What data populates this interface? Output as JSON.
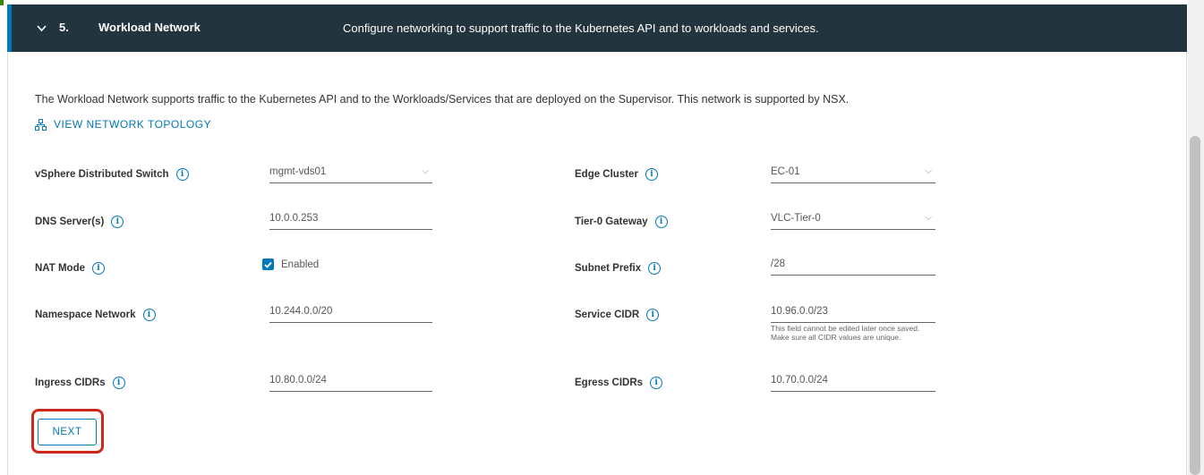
{
  "step": {
    "number": "5.",
    "title": "Workload Network",
    "description": "Configure networking to support traffic to the Kubernetes API and to workloads and services."
  },
  "intro_text": "The Workload Network supports traffic to the Kubernetes API and to the Workloads/Services that are deployed on the Supervisor. This network is supported by NSX.",
  "topology_link": "VIEW NETWORK TOPOLOGY",
  "fields": {
    "vds": {
      "label": "vSphere Distributed Switch",
      "value": "mgmt-vds01"
    },
    "edge_cluster": {
      "label": "Edge Cluster",
      "value": "EC-01"
    },
    "dns": {
      "label": "DNS Server(s)",
      "value": "10.0.0.253"
    },
    "tier0": {
      "label": "Tier-0 Gateway",
      "value": "VLC-Tier-0"
    },
    "nat": {
      "label": "NAT Mode",
      "value": "Enabled"
    },
    "subnet_prefix": {
      "label": "Subnet Prefix",
      "value": "/28"
    },
    "namespace_network": {
      "label": "Namespace Network",
      "value": "10.244.0.0/20"
    },
    "service_cidr": {
      "label": "Service CIDR",
      "value": "10.96.0.0/23",
      "hint": "This field cannot be edited later once saved. Make sure all CIDR values are unique."
    },
    "ingress": {
      "label": "Ingress CIDRs",
      "value": "10.80.0.0/24"
    },
    "egress": {
      "label": "Egress CIDRs",
      "value": "10.70.0.0/24"
    }
  },
  "next_button": "NEXT",
  "colors": {
    "header_bg": "#22343d",
    "accent": "#0079b8",
    "highlight": "#d0271d"
  }
}
